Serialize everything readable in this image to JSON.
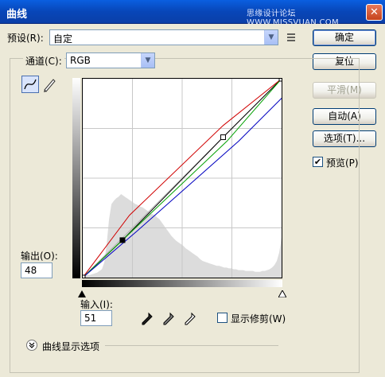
{
  "window": {
    "title": "曲线",
    "watermark": "思缘设计论坛 WWW.MISSVUAN.COM",
    "close_glyph": "✕"
  },
  "preset": {
    "label": "预设(R):",
    "value": "自定"
  },
  "channel": {
    "label": "通道(C):",
    "value": "RGB"
  },
  "buttons": {
    "ok": "确定",
    "reset": "复位",
    "smooth": "平滑(M)",
    "auto": "自动(A)",
    "options": "选项(T)..."
  },
  "preview": {
    "label": "预览(P)",
    "checked": true
  },
  "output": {
    "label": "输出(O):",
    "value": "48"
  },
  "input": {
    "label": "输入(I):",
    "value": "51"
  },
  "clipping": {
    "label": "显示修剪(W)",
    "checked": false
  },
  "curve_display": {
    "label": "曲线显示选项"
  },
  "icons": {
    "preset_menu": "preset-menu-icon",
    "expand": "chevron-down-circle-icon"
  },
  "chart_data": {
    "type": "line",
    "xlim": [
      0,
      255
    ],
    "ylim": [
      0,
      255
    ],
    "grid": "4x4",
    "histogram": [
      4,
      3,
      3,
      3,
      4,
      5,
      6,
      8,
      10,
      18,
      40,
      70,
      88,
      92,
      95,
      97,
      100,
      98,
      96,
      94,
      92,
      90,
      88,
      87,
      85,
      84,
      82,
      80,
      78,
      76,
      75,
      72,
      70,
      66,
      62,
      58,
      54,
      50,
      47,
      44,
      42,
      40,
      38,
      35,
      33,
      31,
      29,
      27,
      25,
      22,
      20,
      19,
      18,
      17,
      16,
      15,
      14,
      14,
      13,
      12,
      12,
      11,
      11,
      10,
      10,
      9,
      9,
      9,
      8,
      8,
      8,
      8,
      7,
      7,
      7,
      8,
      8,
      9,
      10,
      12,
      15,
      20,
      30,
      48
    ],
    "series": [
      {
        "color": "#000000",
        "points": [
          [
            0,
            0
          ],
          [
            51,
            48
          ],
          [
            180,
            180
          ],
          [
            255,
            255
          ]
        ]
      },
      {
        "color": "#d00000",
        "points": [
          [
            0,
            0
          ],
          [
            60,
            80
          ],
          [
            180,
            195
          ],
          [
            255,
            255
          ]
        ]
      },
      {
        "color": "#00a000",
        "points": [
          [
            0,
            0
          ],
          [
            51,
            48
          ],
          [
            185,
            175
          ],
          [
            255,
            255
          ]
        ]
      },
      {
        "color": "#0000c0",
        "points": [
          [
            0,
            0
          ],
          [
            70,
            60
          ],
          [
            200,
            175
          ],
          [
            255,
            230
          ]
        ]
      }
    ],
    "control_points": [
      [
        51,
        48
      ],
      [
        180,
        180
      ],
      [
        0,
        0
      ],
      [
        255,
        255
      ]
    ]
  }
}
